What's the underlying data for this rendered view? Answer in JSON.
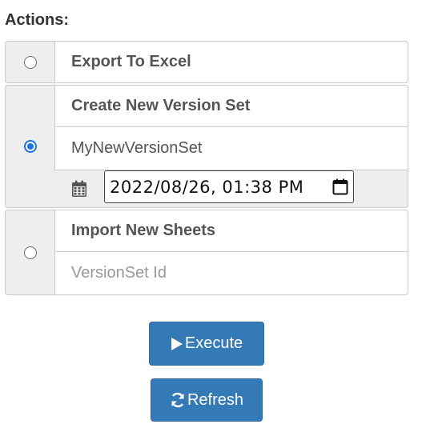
{
  "actions_label": "Actions:",
  "options": [
    {
      "title": "Export To Excel",
      "selected": false
    },
    {
      "title": "Create New Version Set",
      "selected": true,
      "name_value": "MyNewVersionSet",
      "datetime_value": "2022/08/26, 01:38 PM"
    },
    {
      "title": "Import New Sheets",
      "selected": false,
      "id_placeholder": "VersionSet Id"
    }
  ],
  "buttons": {
    "execute_label": "Execute",
    "refresh_label": "Refresh"
  },
  "colors": {
    "accent": "#337ab7",
    "radio_checked": "#1a73e8"
  }
}
